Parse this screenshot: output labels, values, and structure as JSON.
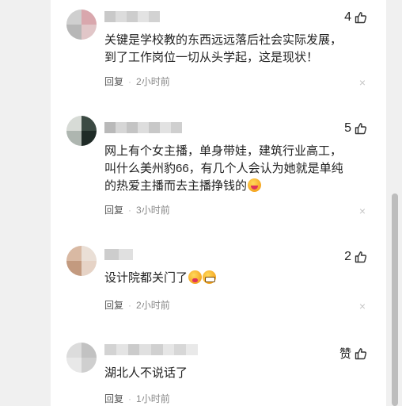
{
  "comments": [
    {
      "likes": "4",
      "text": "关键是学校教的东西远远落后社会实际发展，到了工作岗位一切从头学起，这是现状！",
      "reply_label": "回复",
      "separator": "·",
      "time": "2小时前"
    },
    {
      "likes": "5",
      "text": "网上有个女主播，单身带娃，建筑行业高工，叫什么美州豹66，有几个人会认为她就是单纯的热爱主播而去主播挣钱的",
      "reply_label": "回复",
      "separator": "·",
      "time": "3小时前"
    },
    {
      "likes": "2",
      "text": "设计院都关门了",
      "reply_label": "回复",
      "separator": "·",
      "time": "2小时前"
    },
    {
      "likes": "赞",
      "text": "湖北人不说话了",
      "reply_label": "回复",
      "separator": "·",
      "time": "1小时前"
    }
  ],
  "icons": {
    "thumb": "thumbs-up-icon",
    "close": "close-icon",
    "close_glyph": "×"
  },
  "colors": {
    "text": "#222222",
    "meta": "#888888",
    "background": "#ffffff",
    "page": "#f0f0f0"
  }
}
